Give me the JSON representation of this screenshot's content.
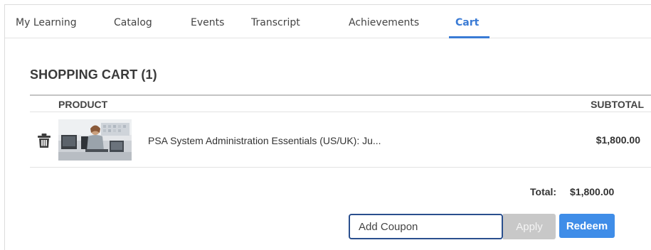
{
  "tabs": [
    {
      "label": "My Learning"
    },
    {
      "label": "Catalog"
    },
    {
      "label": "Events"
    },
    {
      "label": "Transcript"
    },
    {
      "label": "Achievements"
    },
    {
      "label": "Cart",
      "active": true
    }
  ],
  "cart": {
    "heading": "SHOPPING CART (1)",
    "columns": {
      "product": "PRODUCT",
      "subtotal": "SUBTOTAL"
    },
    "items": [
      {
        "name": "PSA System Administration Essentials (US/UK): Ju...",
        "price": "$1,800.00",
        "thumbnail": "person-at-desk-photo"
      }
    ],
    "total_label": "Total:",
    "total_value": "$1,800.00"
  },
  "coupon": {
    "placeholder": "Add Coupon",
    "apply_label": "Apply",
    "redeem_label": "Redeem"
  },
  "colors": {
    "accent": "#3a7bd5",
    "redeem": "#3f8de8",
    "apply_disabled": "#c8c8c8",
    "input_border": "#2a4f8e"
  },
  "icons": {
    "delete": "trash-icon"
  }
}
